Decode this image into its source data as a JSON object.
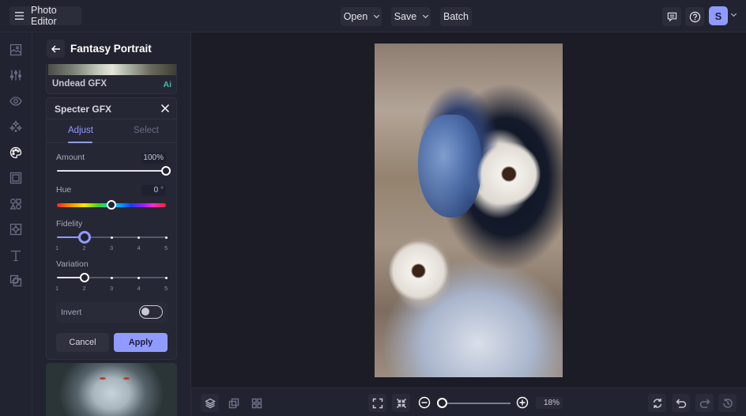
{
  "topbar": {
    "app_title": "Photo Editor",
    "menu_icon": "hamburger-menu-icon",
    "open_label": "Open",
    "save_label": "Save",
    "batch_label": "Batch",
    "feedback_icon": "feedback-icon",
    "help_icon": "help-icon",
    "avatar_initial": "S",
    "accent_color": "#8f9bff"
  },
  "sidebar": {
    "items": [
      {
        "name": "image-icon",
        "active": false
      },
      {
        "name": "adjustments-icon",
        "active": false
      },
      {
        "name": "eye-icon",
        "active": false
      },
      {
        "name": "sparkles-icon",
        "active": false
      },
      {
        "name": "palette-icon",
        "active": true
      },
      {
        "name": "frame-icon",
        "active": false
      },
      {
        "name": "shapes-icon",
        "active": false
      },
      {
        "name": "texture-icon",
        "active": false
      },
      {
        "name": "text-icon",
        "active": false
      },
      {
        "name": "overlay-icon",
        "active": false
      }
    ]
  },
  "panel": {
    "title": "Fantasy Portrait",
    "prev_effect": {
      "label": "Undead GFX",
      "badge": "Ai"
    },
    "effect": {
      "title": "Specter GFX",
      "tabs": [
        {
          "label": "Adjust",
          "active": true
        },
        {
          "label": "Select",
          "active": false
        }
      ],
      "amount": {
        "label": "Amount",
        "value": "100%",
        "fraction": 1.0
      },
      "hue": {
        "label": "Hue",
        "value": "0",
        "unit": "°",
        "fraction": 0.5
      },
      "fidelity": {
        "label": "Fidelity",
        "value": 2,
        "ticks": [
          "1",
          "2",
          "3",
          "4",
          "5"
        ]
      },
      "variation": {
        "label": "Variation",
        "value": 2,
        "ticks": [
          "1",
          "2",
          "3",
          "4",
          "5"
        ]
      },
      "invert": {
        "label": "Invert",
        "on": false
      },
      "cancel_label": "Cancel",
      "apply_label": "Apply"
    }
  },
  "bottombar": {
    "zoom_value": "18%",
    "zoom_fraction": 0.0
  }
}
